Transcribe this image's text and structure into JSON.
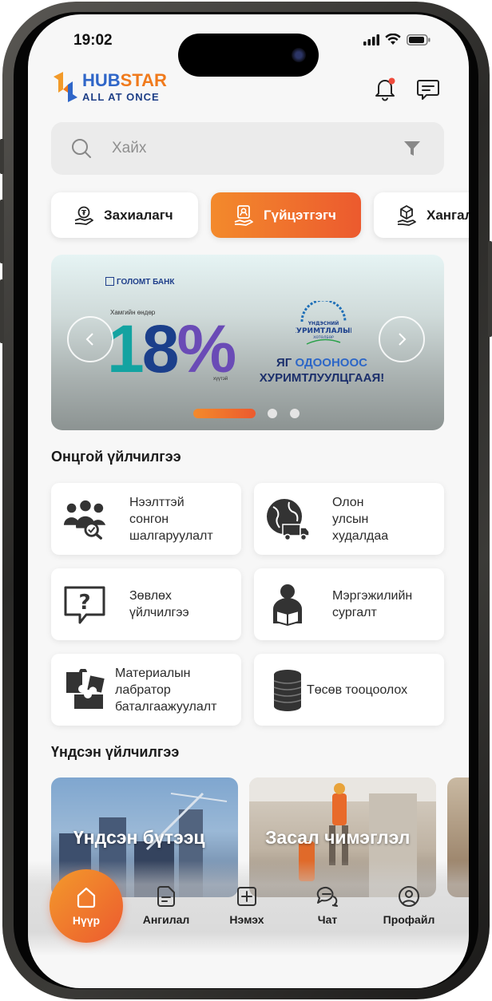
{
  "status": {
    "time": "19:02"
  },
  "brand": {
    "name_part1": "HUB",
    "name_part2": "STAR",
    "tagline": "ALL  AT ONCE"
  },
  "search": {
    "placeholder": "Хайх"
  },
  "segments": [
    {
      "label": "Захиалагч",
      "icon": "hand-coin-icon",
      "active": false
    },
    {
      "label": "Гүйцэтгэгч",
      "icon": "hand-person-icon",
      "active": true
    },
    {
      "label": "Хангал",
      "icon": "hand-box-icon",
      "active": false
    }
  ],
  "banner": {
    "bank": "ГОЛОМТ БАНК",
    "max_label": "Хамгийн өндөр",
    "rate": "18%",
    "rate_suffix": "хүүтэй",
    "seal_line1": "ҮНДЭСНИЙ",
    "seal_line2": "ХУРИМТЛАЛЫН",
    "seal_line3": "ХӨТӨЛБӨР",
    "slogan_prefix": "ЯГ ",
    "slogan_highlight": "ОДООНООС",
    "slogan_line2": "ХУРИМТЛУУЛЦГААЯ!",
    "slides_total": 3,
    "active_slide": 1
  },
  "sections": {
    "featured_title": "Онцгой үйлчилгээ",
    "main_title": "Үндсэн үйлчилгээ"
  },
  "featured": [
    {
      "label": "Нээлттэй\nсонгон\nшалгаруулалт",
      "icon": "team-search-icon"
    },
    {
      "label": "Олон\nулсын\nхудалдаа",
      "icon": "globe-truck-icon"
    },
    {
      "label": "Зөвлөх\nүйлчилгээ",
      "icon": "question-chat-icon"
    },
    {
      "label": "Мэргэжилийн\nсургалт",
      "icon": "reader-icon"
    },
    {
      "label": "Материалын\nлабратор\nбаталгаажуулалт",
      "icon": "puzzle-icon"
    },
    {
      "label": "Төсөв тооцоолох",
      "icon": "coin-stack-icon"
    }
  ],
  "main_services": [
    {
      "label": "Үндсэн бүтээц"
    },
    {
      "label": "Засал чимэглэл"
    }
  ],
  "tabs": [
    {
      "label": "Нүүр",
      "icon": "home-icon",
      "active": true
    },
    {
      "label": "Ангилал",
      "icon": "category-icon"
    },
    {
      "label": "Нэмэх",
      "icon": "add-icon"
    },
    {
      "label": "Чат",
      "icon": "chat-icon"
    },
    {
      "label": "Профайл",
      "icon": "profile-icon"
    }
  ],
  "colors": {
    "accent_start": "#f38a2c",
    "accent_end": "#ec5a2e",
    "brand_blue": "#2f66c8"
  }
}
